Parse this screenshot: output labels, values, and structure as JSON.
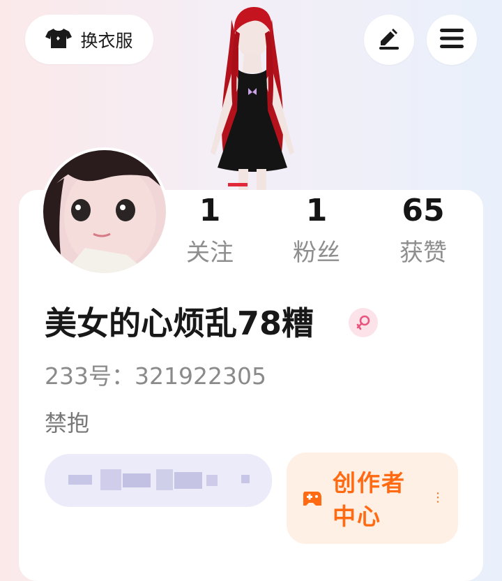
{
  "header": {
    "outfit_label": "换衣服",
    "icons": [
      "shirt-icon",
      "pen-icon",
      "menu-icon"
    ]
  },
  "stats": [
    {
      "value": "1",
      "label": "关注"
    },
    {
      "value": "1",
      "label": "粉丝"
    },
    {
      "value": "65",
      "label": "获赞"
    }
  ],
  "profile": {
    "username": "美女的心烦乱78糟",
    "gender_icon": "female-icon",
    "uid": "233号：321922305",
    "bio": "禁抱"
  },
  "creator": {
    "label": "创作者中心"
  },
  "colors": {
    "accent": "#ff6a12",
    "creator_bg": "#fff0e5",
    "blur_pill_bg": "#ecebfa",
    "gender_badge": "#fce3ea"
  }
}
